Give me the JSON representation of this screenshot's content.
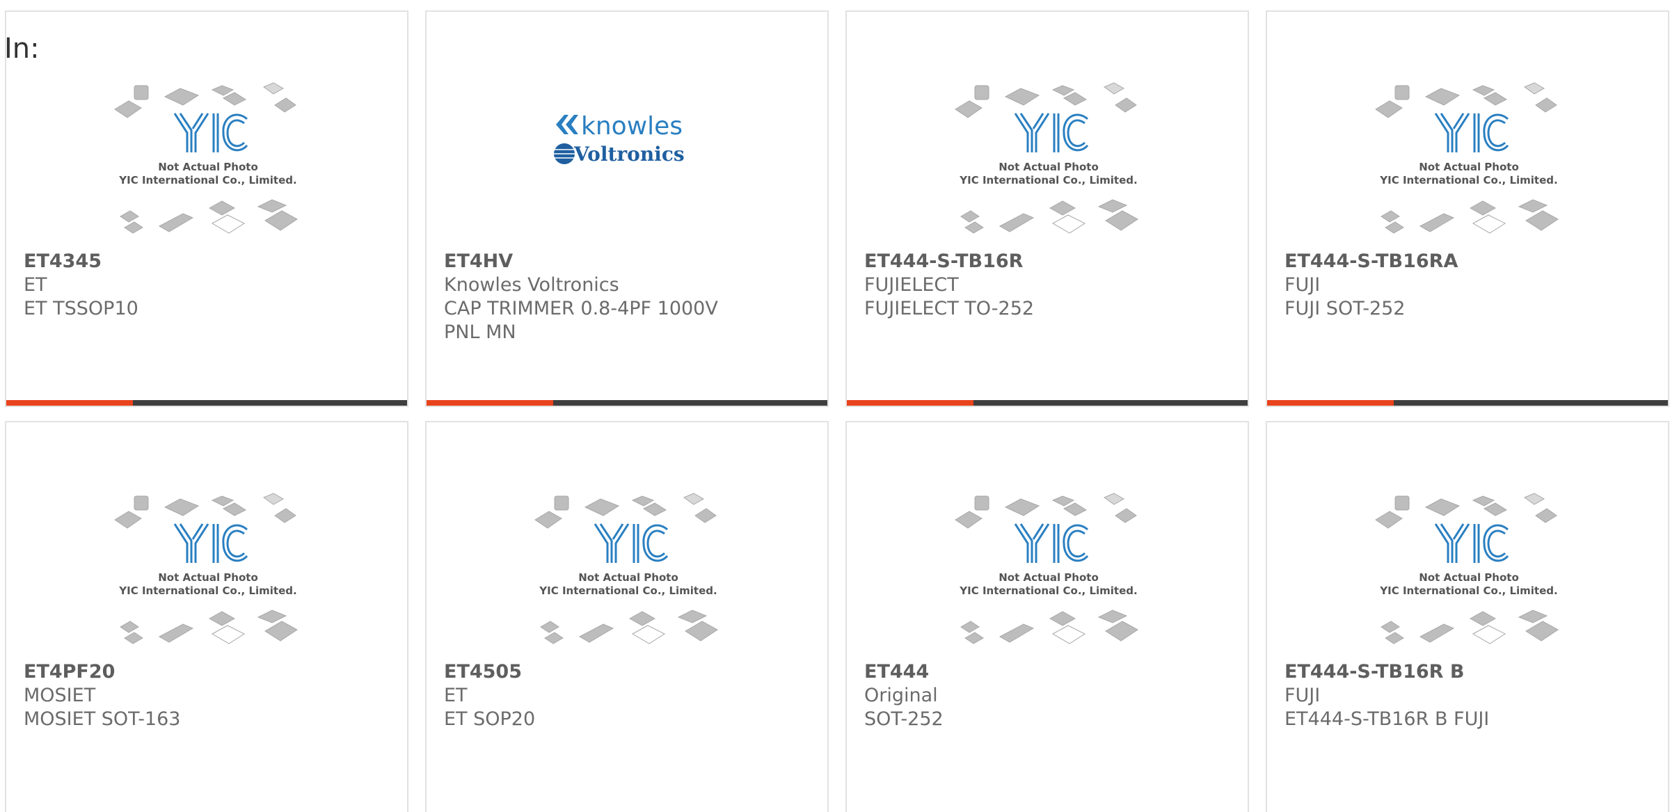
{
  "header": {
    "label": "In:"
  },
  "placeholder_image": {
    "caption_line1": "Not Actual Photo",
    "caption_line2": "YIC International Co., Limited.",
    "logo_text": "YIC"
  },
  "brand_logo": {
    "line1": "knowles",
    "line2": "Voltronics"
  },
  "colors": {
    "accent": "#e8431c",
    "bar": "#3f3f3f",
    "logo_blue": "#2a7fc1"
  },
  "products": [
    {
      "part": "ET4345",
      "maker": "ET",
      "desc": "ET TSSOP10",
      "desc2": ""
    },
    {
      "part": "ET4HV",
      "maker": "Knowles Voltronics",
      "desc": "CAP TRIMMER 0.8-4PF 1000V",
      "desc2": "PNL MN"
    },
    {
      "part": "ET444-S-TB16R",
      "maker": "FUJIELECT",
      "desc": "FUJIELECT TO-252",
      "desc2": ""
    },
    {
      "part": "ET444-S-TB16RA",
      "maker": "FUJI",
      "desc": "FUJI SOT-252",
      "desc2": ""
    },
    {
      "part": "ET4PF20",
      "maker": "MOSIET",
      "desc": "MOSIET SOT-163",
      "desc2": ""
    },
    {
      "part": "ET4505",
      "maker": "ET",
      "desc": "ET SOP20",
      "desc2": ""
    },
    {
      "part": "ET444",
      "maker": "Original",
      "desc": "SOT-252",
      "desc2": ""
    },
    {
      "part": "ET444-S-TB16R B",
      "maker": "FUJI",
      "desc": "ET444-S-TB16R B FUJI",
      "desc2": ""
    }
  ]
}
